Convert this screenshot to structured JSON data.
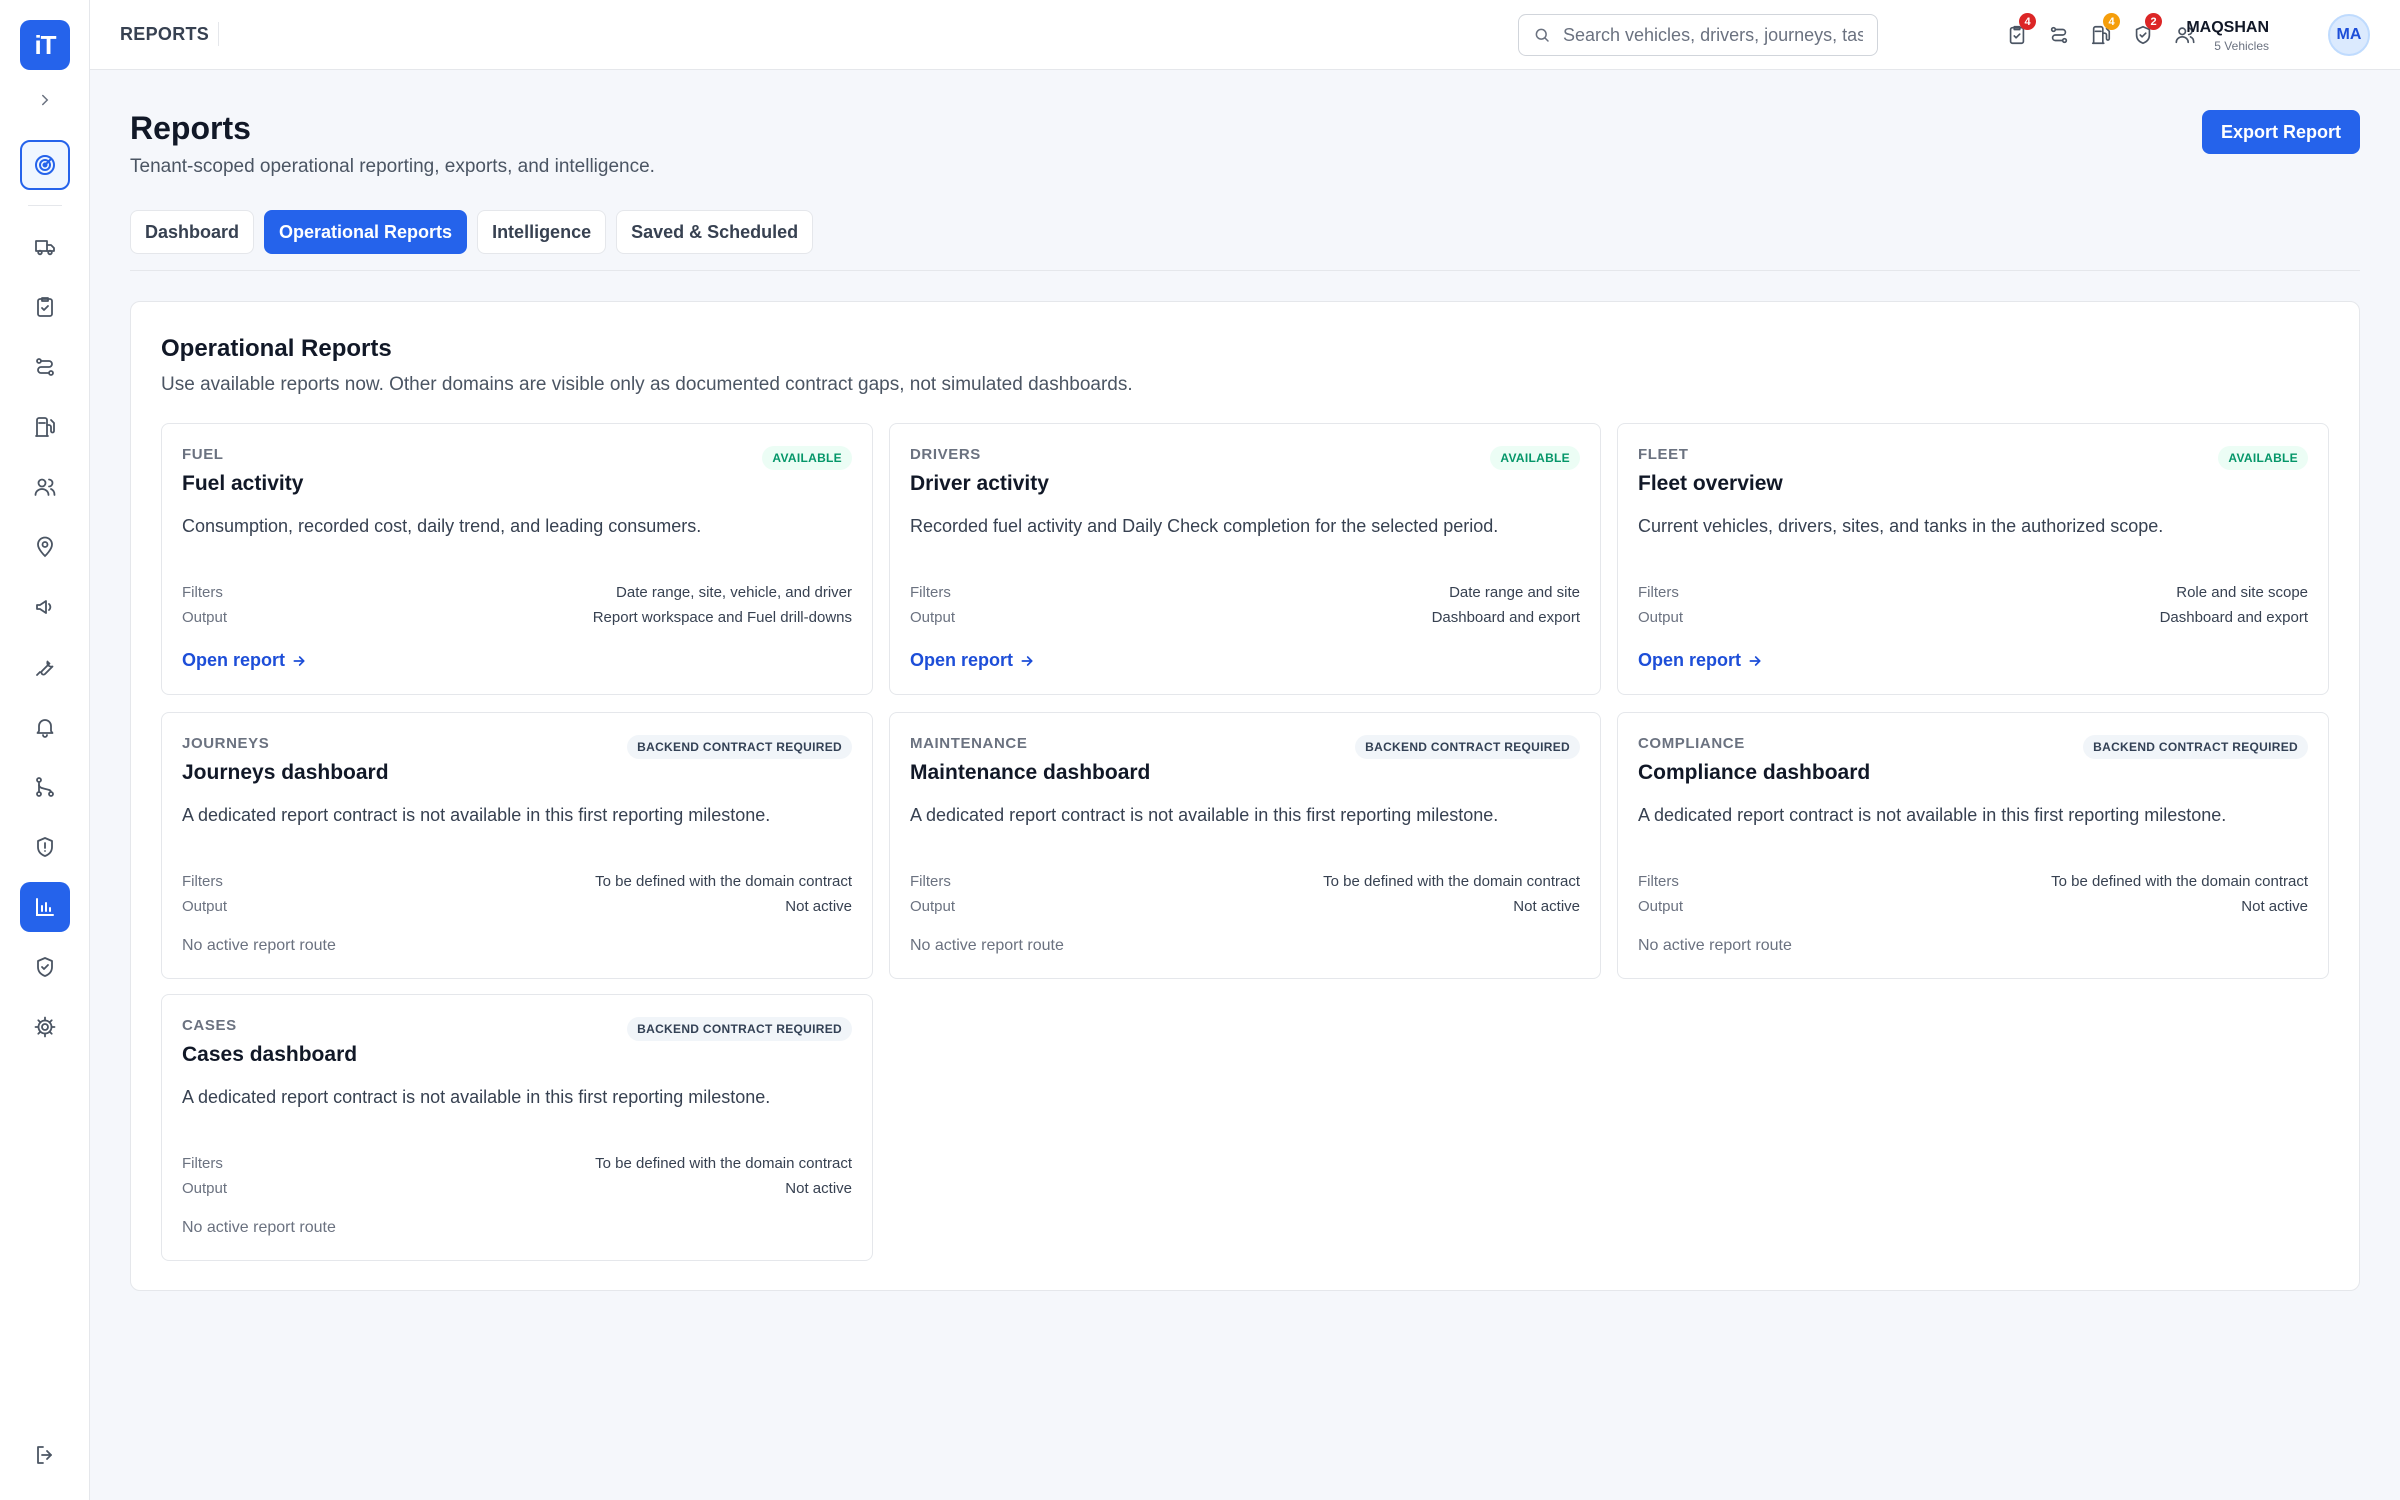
{
  "topbar": {
    "crumb": "REPORTS",
    "search_placeholder": "Search vehicles, drivers, journeys, tasks",
    "badges": {
      "checks": "4",
      "fuel": "4",
      "shield": "2"
    },
    "user_name": "MAQSHAN",
    "user_sub": "5 Vehicles",
    "avatar": "MA"
  },
  "sidebar": {
    "logo": "iT",
    "items": [
      "dashboard",
      "vehicles",
      "daily-checks",
      "journeys",
      "fuel",
      "drivers",
      "sites",
      "tanks",
      "maintenance",
      "alerts",
      "routes",
      "compliance",
      "reports",
      "security",
      "settings",
      "logout"
    ]
  },
  "page": {
    "title": "Reports",
    "subtitle": "Tenant-scoped operational reporting, exports, and intelligence.",
    "export_label": "Export Report",
    "tabs": [
      "Dashboard",
      "Operational Reports",
      "Intelligence",
      "Saved & Scheduled"
    ],
    "active_tab": "Operational Reports"
  },
  "panel": {
    "title": "Operational Reports",
    "subtitle": "Use available reports now. Other domains are visible only as documented contract gaps, not simulated dashboards.",
    "labels": {
      "filters": "Filters",
      "output": "Output",
      "open": "Open report",
      "no_route": "No active report route"
    },
    "cards": [
      {
        "domain": "FUEL",
        "status": "AVAILABLE",
        "title": "Fuel activity",
        "desc": "Consumption, recorded cost, daily trend, and leading consumers.",
        "filters": "Date range, site, vehicle, and driver",
        "output": "Report workspace and Fuel drill-downs"
      },
      {
        "domain": "DRIVERS",
        "status": "AVAILABLE",
        "title": "Driver activity",
        "desc": "Recorded fuel activity and Daily Check completion for the selected period.",
        "filters": "Date range and site",
        "output": "Dashboard and export"
      },
      {
        "domain": "FLEET",
        "status": "AVAILABLE",
        "title": "Fleet overview",
        "desc": "Current vehicles, drivers, sites, and tanks in the authorized scope.",
        "filters": "Role and site scope",
        "output": "Dashboard and export"
      },
      {
        "domain": "JOURNEYS",
        "status": "BACKEND CONTRACT REQUIRED",
        "title": "Journeys dashboard",
        "desc": "A dedicated report contract is not available in this first reporting milestone.",
        "filters": "To be defined with the domain contract",
        "output": "Not active"
      },
      {
        "domain": "MAINTENANCE",
        "status": "BACKEND CONTRACT REQUIRED",
        "title": "Maintenance dashboard",
        "desc": "A dedicated report contract is not available in this first reporting milestone.",
        "filters": "To be defined with the domain contract",
        "output": "Not active"
      },
      {
        "domain": "COMPLIANCE",
        "status": "BACKEND CONTRACT REQUIRED",
        "title": "Compliance dashboard",
        "desc": "A dedicated report contract is not available in this first reporting milestone.",
        "filters": "To be defined with the domain contract",
        "output": "Not active"
      },
      {
        "domain": "CASES",
        "status": "BACKEND CONTRACT REQUIRED",
        "title": "Cases dashboard",
        "desc": "A dedicated report contract is not available in this first reporting milestone.",
        "filters": "To be defined with the domain contract",
        "output": "Not active"
      }
    ]
  },
  "colors": {
    "accent": "#2563eb",
    "available": "#059669",
    "badge_red": "#dc2626",
    "badge_amber": "#f59e0b"
  }
}
